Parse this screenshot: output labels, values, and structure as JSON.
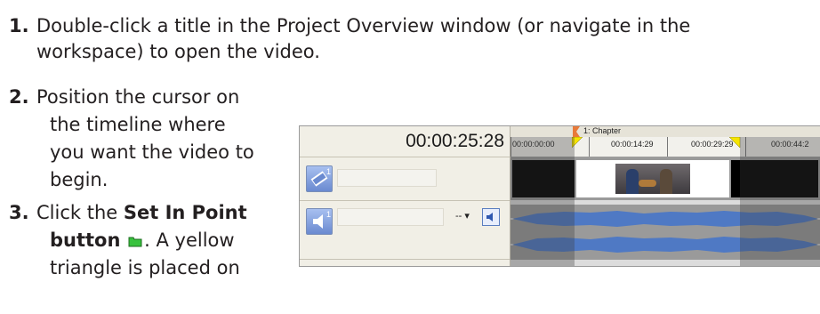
{
  "steps": [
    {
      "number": "1.",
      "lines": [
        "Double-click a title in the Project Overview window (or navigate in the",
        "workspace) to open the video."
      ]
    },
    {
      "number": "2.",
      "lines": [
        "Position the cursor on",
        "the timeline where",
        "you want the video to",
        "begin."
      ]
    },
    {
      "number": "3.",
      "line1_before": "Click the ",
      "line1_bold": "Set In Point",
      "line2_bold": "button",
      "line2_after": ". A yellow",
      "line3": "triangle is placed on"
    }
  ],
  "screenshot": {
    "timecode": "00:00:25:28",
    "chapter_label": "1: Chapter",
    "ruler_labels": [
      "00:00:00:00",
      "00:00:14:29",
      "00:00:29:29",
      "00:00:44:2"
    ],
    "video_track_number": "1",
    "audio_track_number": "1",
    "volume_value": "--",
    "colors": {
      "in_marker": "#f5e400",
      "chapter_marker": "#e87a3a",
      "waveform": "#4f79c4",
      "set_in_icon": "#38c23e"
    },
    "icons": [
      "video-track-icon",
      "audio-track-icon",
      "speaker-icon",
      "chapter-marker-icon",
      "in-point-marker-icon"
    ]
  }
}
